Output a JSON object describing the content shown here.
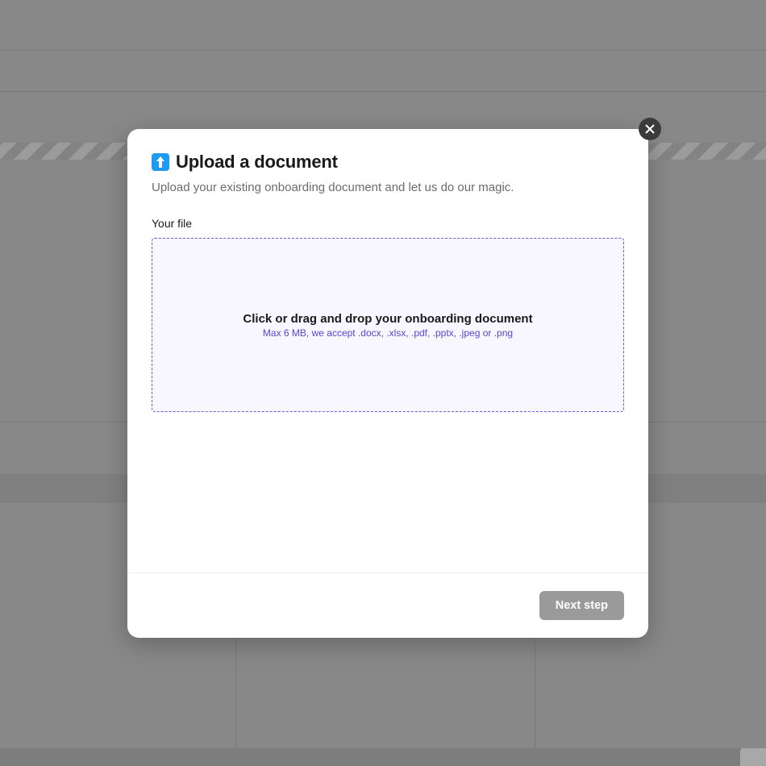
{
  "modal": {
    "title": "Upload a document",
    "subtitle": "Upload your existing onboarding document and let us do our magic.",
    "field_label": "Your file",
    "dropzone": {
      "main": "Click or drag and drop your onboarding document",
      "sub": "Max 6 MB, we accept .docx, .xlsx, .pdf, .pptx, .jpeg or .png"
    },
    "next_button": "Next step"
  }
}
